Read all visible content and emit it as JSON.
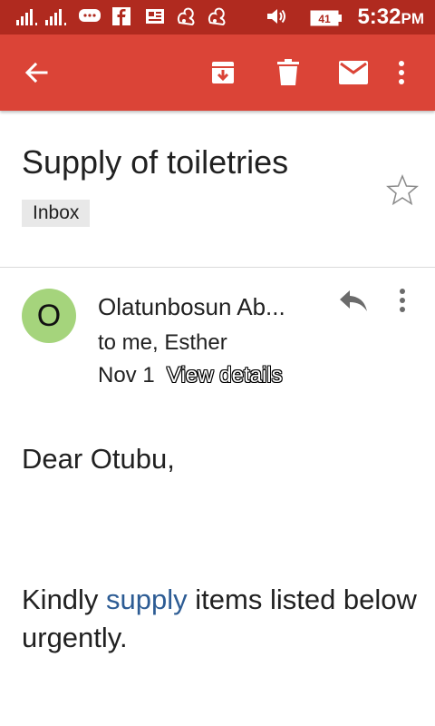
{
  "status_bar": {
    "time": "5:32",
    "ampm": "PM",
    "battery_level": "41",
    "icons": [
      "signal-icon-1",
      "signal-icon-2",
      "message-icon",
      "facebook-icon",
      "news-icon",
      "uc-browser-icon",
      "uc-browser-icon-2",
      "volume-icon",
      "battery-icon"
    ]
  },
  "toolbar": {
    "icons": [
      "back-arrow-icon",
      "archive-icon",
      "delete-icon",
      "mark-unread-icon",
      "more-vert-icon"
    ]
  },
  "email": {
    "subject": "Supply of toiletries",
    "label": "Inbox",
    "sender_initial": "O",
    "sender_name": "Olatunbosun Ab...",
    "recipients": "to me, Esther",
    "date": "Nov 1",
    "view_details": "View details",
    "body": {
      "greeting": "Dear Otubu,",
      "p_before": "Kindly ",
      "p_link": "supply",
      "p_after": " items listed below urgently."
    }
  },
  "colors": {
    "status_bar": "#b02a1f",
    "toolbar": "#db4437",
    "avatar": "#a5d47c",
    "link": "#2d5c94"
  }
}
